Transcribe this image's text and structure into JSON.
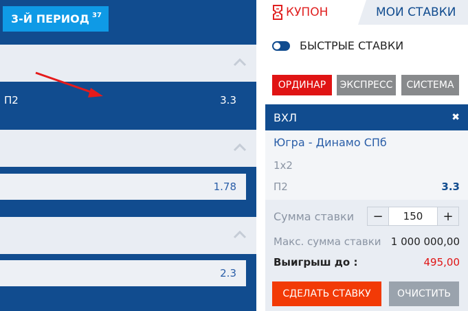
{
  "left": {
    "period_label": "3-Й ПЕРИОД",
    "period_count": "37",
    "rows": [
      {
        "label": "П2",
        "value": "3.3",
        "selected": true
      },
      {
        "label": "",
        "value": "1.78"
      },
      {
        "label": "",
        "value": "2.3"
      }
    ]
  },
  "coupon": {
    "tab_coupon": "КУПОН",
    "tab_mybets": "МОИ СТАВКИ",
    "quick_bets": "БЫСТРЫЕ СТАВКИ",
    "bet_types": [
      "ОРДИНАР",
      "ЭКСПРЕСС",
      "СИСТЕМА"
    ],
    "slip": {
      "league": "ВХЛ",
      "close": "✖",
      "match": "Югра - Динамо СПб",
      "market": "1x2",
      "selection": "П2",
      "odd": "3.3"
    },
    "stake_label": "Сумма ставки",
    "stake_minus": "−",
    "stake_value": "150",
    "stake_plus": "+",
    "max_label": "Макс. сумма ставки",
    "max_value": "1 000 000,00",
    "win_label": "Выигрыш до :",
    "win_value": "495,00",
    "place_bet": "СДЕЛАТЬ СТАВКУ",
    "clear": "ОЧИСТИТЬ"
  },
  "colors": {
    "primary": "#114c8f",
    "accent_red": "#e01414",
    "place_bet": "#f23a06",
    "period_badge": "#0f9ae6"
  },
  "icons": [
    "chevron-up-icon",
    "coupon-ticket-icon",
    "close-icon",
    "annotation-arrow-icon"
  ]
}
